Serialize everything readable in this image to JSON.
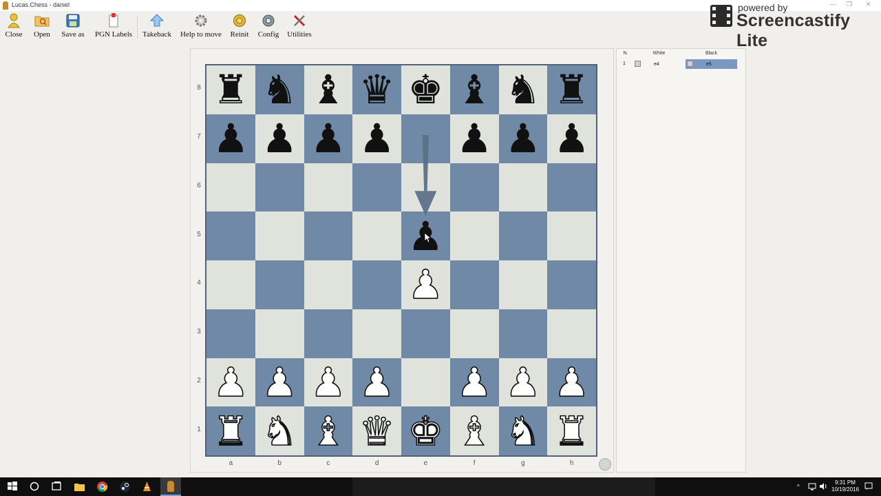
{
  "window": {
    "title": "Lucas.Chess - daniel"
  },
  "toolbar": {
    "items": [
      {
        "label": "Close",
        "icon": "close-person-icon"
      },
      {
        "label": "Open",
        "icon": "folder-search-icon"
      },
      {
        "label": "Save as",
        "icon": "floppy-disk-icon"
      },
      {
        "label": "PGN Labels",
        "icon": "label-clip-icon"
      },
      {
        "label": "Takeback",
        "icon": "arrow-up-icon"
      },
      {
        "label": "Help to move",
        "icon": "gear-help-icon"
      },
      {
        "label": "Reinit",
        "icon": "coin-reinit-icon"
      },
      {
        "label": "Config",
        "icon": "gear-config-icon"
      },
      {
        "label": "Utilities",
        "icon": "tools-icon"
      }
    ]
  },
  "watermark": {
    "powered": "powered by",
    "brand": "Screencastify Lite"
  },
  "board": {
    "ranks": [
      "8",
      "7",
      "6",
      "5",
      "4",
      "3",
      "2",
      "1"
    ],
    "files": [
      "a",
      "b",
      "c",
      "d",
      "e",
      "f",
      "g",
      "h"
    ],
    "light_color": "#dfe3dc",
    "dark_color": "#7089a6",
    "position": [
      [
        "r",
        "n",
        "b",
        "q",
        "k",
        "b",
        "n",
        "r"
      ],
      [
        "p",
        "p",
        "p",
        "p",
        "",
        "p",
        "p",
        "p"
      ],
      [
        "",
        "",
        "",
        "",
        "",
        "",
        "",
        ""
      ],
      [
        "",
        "",
        "",
        "",
        "p",
        "",
        "",
        ""
      ],
      [
        "",
        "",
        "",
        "",
        "P",
        "",
        "",
        ""
      ],
      [
        "",
        "",
        "",
        "",
        "",
        "",
        "",
        ""
      ],
      [
        "P",
        "P",
        "P",
        "P",
        "",
        "P",
        "P",
        "P"
      ],
      [
        "R",
        "N",
        "B",
        "Q",
        "K",
        "B",
        "N",
        "R"
      ]
    ],
    "last_move_arrow": {
      "from": "e7",
      "to": "e5",
      "color": "#5a6e86"
    }
  },
  "movelist": {
    "headers": {
      "n": "N.",
      "white": "White",
      "black": "Black"
    },
    "rows": [
      {
        "n": "1",
        "white": "e4",
        "black": "e5",
        "selected": "black"
      }
    ]
  },
  "taskbar": {
    "time": "9:31 PM",
    "date": "10/19/2016",
    "apps": [
      "windows-start-icon",
      "search-circle-icon",
      "task-view-icon",
      "file-explorer-icon",
      "chrome-icon",
      "steam-icon",
      "vlc-icon",
      "lucas-chess-icon"
    ]
  }
}
